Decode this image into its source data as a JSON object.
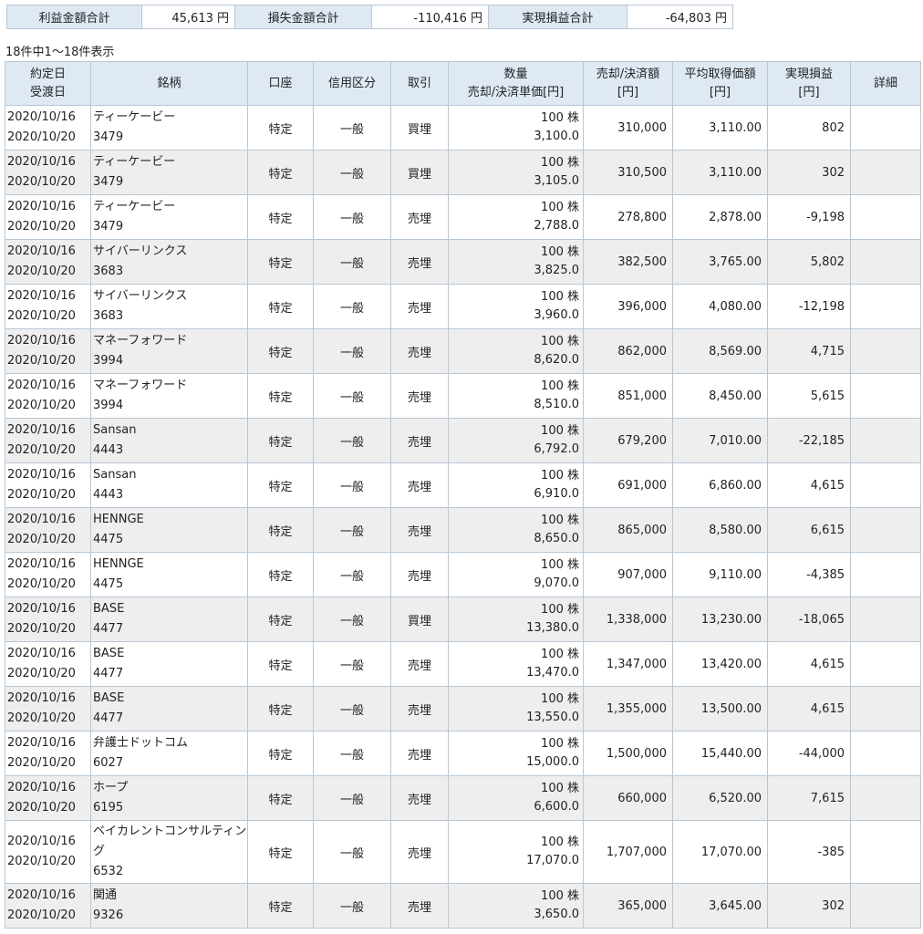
{
  "summary": {
    "profit_label": "利益金額合計",
    "profit_value": "45,613 円",
    "loss_label": "損失金額合計",
    "loss_value": "-110,416 円",
    "realized_label": "実現損益合計",
    "realized_value": "-64,803 円"
  },
  "count_text": "18件中1〜18件表示",
  "headers": {
    "date_line1": "約定日",
    "date_line2": "受渡日",
    "name": "銘柄",
    "account": "口座",
    "credit": "信用区分",
    "trade": "取引",
    "qty_line1": "数量",
    "qty_line2": "売却/決済単価[円]",
    "amount_line1": "売却/決済額",
    "amount_line2": "[円]",
    "avg_line1": "平均取得価額",
    "avg_line2": "[円]",
    "pl_line1": "実現損益",
    "pl_line2": "[円]",
    "detail": "詳細"
  },
  "rows": [
    {
      "trade_date": "2020/10/16",
      "settle_date": "2020/10/20",
      "name": "ティーケービー",
      "code": "3479",
      "account": "特定",
      "credit": "一般",
      "trade": "買埋",
      "qty": "100 株",
      "price": "3,100.0",
      "amount": "310,000",
      "avg": "3,110.00",
      "pl": "802"
    },
    {
      "trade_date": "2020/10/16",
      "settle_date": "2020/10/20",
      "name": "ティーケービー",
      "code": "3479",
      "account": "特定",
      "credit": "一般",
      "trade": "買埋",
      "qty": "100 株",
      "price": "3,105.0",
      "amount": "310,500",
      "avg": "3,110.00",
      "pl": "302"
    },
    {
      "trade_date": "2020/10/16",
      "settle_date": "2020/10/20",
      "name": "ティーケービー",
      "code": "3479",
      "account": "特定",
      "credit": "一般",
      "trade": "売埋",
      "qty": "100 株",
      "price": "2,788.0",
      "amount": "278,800",
      "avg": "2,878.00",
      "pl": "-9,198"
    },
    {
      "trade_date": "2020/10/16",
      "settle_date": "2020/10/20",
      "name": "サイバーリンクス",
      "code": "3683",
      "account": "特定",
      "credit": "一般",
      "trade": "売埋",
      "qty": "100 株",
      "price": "3,825.0",
      "amount": "382,500",
      "avg": "3,765.00",
      "pl": "5,802"
    },
    {
      "trade_date": "2020/10/16",
      "settle_date": "2020/10/20",
      "name": "サイバーリンクス",
      "code": "3683",
      "account": "特定",
      "credit": "一般",
      "trade": "売埋",
      "qty": "100 株",
      "price": "3,960.0",
      "amount": "396,000",
      "avg": "4,080.00",
      "pl": "-12,198"
    },
    {
      "trade_date": "2020/10/16",
      "settle_date": "2020/10/20",
      "name": "マネーフォワード",
      "code": "3994",
      "account": "特定",
      "credit": "一般",
      "trade": "売埋",
      "qty": "100 株",
      "price": "8,620.0",
      "amount": "862,000",
      "avg": "8,569.00",
      "pl": "4,715"
    },
    {
      "trade_date": "2020/10/16",
      "settle_date": "2020/10/20",
      "name": "マネーフォワード",
      "code": "3994",
      "account": "特定",
      "credit": "一般",
      "trade": "売埋",
      "qty": "100 株",
      "price": "8,510.0",
      "amount": "851,000",
      "avg": "8,450.00",
      "pl": "5,615"
    },
    {
      "trade_date": "2020/10/16",
      "settle_date": "2020/10/20",
      "name": "Sansan",
      "code": "4443",
      "account": "特定",
      "credit": "一般",
      "trade": "売埋",
      "qty": "100 株",
      "price": "6,792.0",
      "amount": "679,200",
      "avg": "7,010.00",
      "pl": "-22,185"
    },
    {
      "trade_date": "2020/10/16",
      "settle_date": "2020/10/20",
      "name": "Sansan",
      "code": "4443",
      "account": "特定",
      "credit": "一般",
      "trade": "売埋",
      "qty": "100 株",
      "price": "6,910.0",
      "amount": "691,000",
      "avg": "6,860.00",
      "pl": "4,615"
    },
    {
      "trade_date": "2020/10/16",
      "settle_date": "2020/10/20",
      "name": "HENNGE",
      "code": "4475",
      "account": "特定",
      "credit": "一般",
      "trade": "売埋",
      "qty": "100 株",
      "price": "8,650.0",
      "amount": "865,000",
      "avg": "8,580.00",
      "pl": "6,615"
    },
    {
      "trade_date": "2020/10/16",
      "settle_date": "2020/10/20",
      "name": "HENNGE",
      "code": "4475",
      "account": "特定",
      "credit": "一般",
      "trade": "売埋",
      "qty": "100 株",
      "price": "9,070.0",
      "amount": "907,000",
      "avg": "9,110.00",
      "pl": "-4,385"
    },
    {
      "trade_date": "2020/10/16",
      "settle_date": "2020/10/20",
      "name": "BASE",
      "code": "4477",
      "account": "特定",
      "credit": "一般",
      "trade": "買埋",
      "qty": "100 株",
      "price": "13,380.0",
      "amount": "1,338,000",
      "avg": "13,230.00",
      "pl": "-18,065"
    },
    {
      "trade_date": "2020/10/16",
      "settle_date": "2020/10/20",
      "name": "BASE",
      "code": "4477",
      "account": "特定",
      "credit": "一般",
      "trade": "売埋",
      "qty": "100 株",
      "price": "13,470.0",
      "amount": "1,347,000",
      "avg": "13,420.00",
      "pl": "4,615"
    },
    {
      "trade_date": "2020/10/16",
      "settle_date": "2020/10/20",
      "name": "BASE",
      "code": "4477",
      "account": "特定",
      "credit": "一般",
      "trade": "売埋",
      "qty": "100 株",
      "price": "13,550.0",
      "amount": "1,355,000",
      "avg": "13,500.00",
      "pl": "4,615"
    },
    {
      "trade_date": "2020/10/16",
      "settle_date": "2020/10/20",
      "name": "弁護士ドットコム",
      "code": "6027",
      "account": "特定",
      "credit": "一般",
      "trade": "売埋",
      "qty": "100 株",
      "price": "15,000.0",
      "amount": "1,500,000",
      "avg": "15,440.00",
      "pl": "-44,000"
    },
    {
      "trade_date": "2020/10/16",
      "settle_date": "2020/10/20",
      "name": "ホープ",
      "code": "6195",
      "account": "特定",
      "credit": "一般",
      "trade": "売埋",
      "qty": "100 株",
      "price": "6,600.0",
      "amount": "660,000",
      "avg": "6,520.00",
      "pl": "7,615"
    },
    {
      "trade_date": "2020/10/16",
      "settle_date": "2020/10/20",
      "name": "ベイカレントコンサルティング",
      "code": "6532",
      "account": "特定",
      "credit": "一般",
      "trade": "売埋",
      "qty": "100 株",
      "price": "17,070.0",
      "amount": "1,707,000",
      "avg": "17,070.00",
      "pl": "-385"
    },
    {
      "trade_date": "2020/10/16",
      "settle_date": "2020/10/20",
      "name": "関通",
      "code": "9326",
      "account": "特定",
      "credit": "一般",
      "trade": "売埋",
      "qty": "100 株",
      "price": "3,650.0",
      "amount": "365,000",
      "avg": "3,645.00",
      "pl": "302"
    }
  ]
}
